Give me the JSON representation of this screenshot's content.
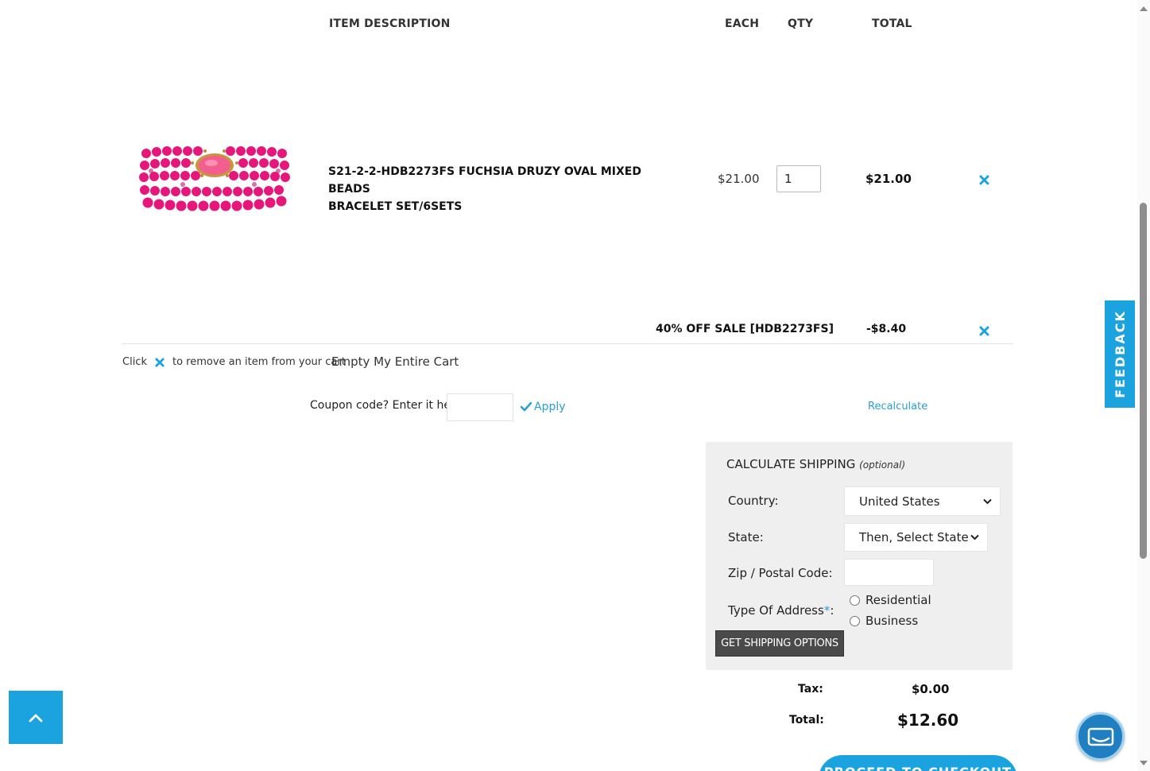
{
  "table_header": {
    "item_description": "ITEM  DESCRIPTION",
    "each": "EACH",
    "qty": "QTY",
    "total": "TOTAL"
  },
  "cart_item": {
    "name_line1": "S21-2-2-HDB2273FS FUCHSIA DRUZY OVAL MIXED BEADS",
    "name_line2": "BRACELET SET/6SETS",
    "each_price": "$21.00",
    "qty": "1",
    "line_total": "$21.00",
    "image_icon": "beaded-bracelet-image"
  },
  "discount": {
    "label": "40% OFF SALE [HDB2273FS]",
    "amount": "-$8.40"
  },
  "remove_hint": {
    "prefix": "Click",
    "suffix": "to remove an item from your cart",
    "empty_cart": "Empty My Entire Cart"
  },
  "coupon": {
    "label": "Coupon code? Enter it here:",
    "value": "",
    "apply": "Apply",
    "recalculate": "Recalculate"
  },
  "shipping": {
    "title": "CALCULATE SHIPPING",
    "optional": "(optional)",
    "country_label": "Country:",
    "country_value": "United States",
    "state_label": "State:",
    "state_value": "Then, Select State",
    "zip_label": "Zip / Postal Code:",
    "zip_value": "",
    "address_type_label": "Type Of Address",
    "required_mark": "*",
    "colon": ":",
    "residential": "Residential",
    "business": "Business",
    "button": "GET SHIPPING OPTIONS"
  },
  "summary": {
    "tax_label": "Tax:",
    "tax_value": "$0.00",
    "total_label": "Total:",
    "total_value": "$12.60"
  },
  "checkout_button": "PROCEED TO CHECKOUT",
  "feedback": "FEEDBACK",
  "colors": {
    "accent": "#1aa3df",
    "link": "#2a9fd6",
    "remove_x": "#1aa3df",
    "shipping_box_bg": "#efefef",
    "dark_button": "#4a4a4a"
  }
}
